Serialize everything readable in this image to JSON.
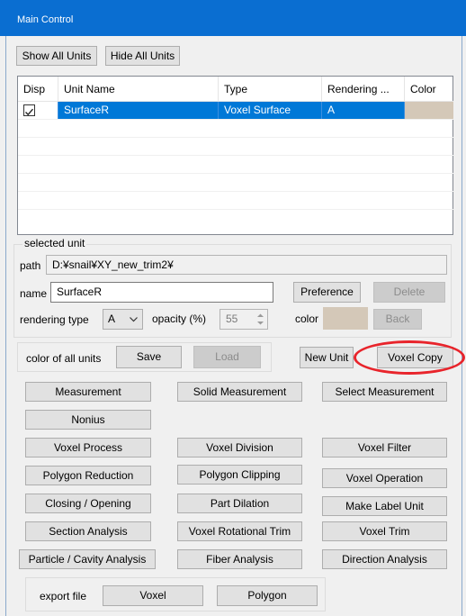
{
  "window": {
    "title": "Main Control"
  },
  "toolbar": {
    "show_all": "Show All Units",
    "hide_all": "Hide All Units"
  },
  "grid": {
    "columns": [
      "Disp",
      "Unit Name",
      "Type",
      "Rendering ...",
      "Color"
    ],
    "rows": [
      {
        "disp_checked": true,
        "name": "SurfaceR",
        "type": "Voxel Surface",
        "rendering": "A",
        "color": "#d4c8b8"
      }
    ]
  },
  "selected": {
    "group_title": "selected unit",
    "path_label": "path",
    "path_value": "D:¥snail¥XY_new_trim2¥",
    "name_label": "name",
    "name_value": "SurfaceR",
    "preference": "Preference",
    "delete": "Delete",
    "rendering_label": "rendering type",
    "rendering_value": "A",
    "opacity_label": "opacity (%)",
    "opacity_value": "55",
    "color_label": "color",
    "color_value": "#d4c8b8",
    "back": "Back"
  },
  "allunits": {
    "label": "color of all units",
    "save": "Save",
    "load": "Load"
  },
  "actions": {
    "new_unit": "New Unit",
    "voxel_copy": "Voxel Copy"
  },
  "tools": {
    "measurement": "Measurement",
    "solid_measurement": "Solid Measurement",
    "select_measurement": "Select Measurement",
    "nonius": "Nonius",
    "voxel_process": "Voxel Process",
    "voxel_division": "Voxel Division",
    "voxel_filter": "Voxel Filter",
    "polygon_reduction": "Polygon Reduction",
    "polygon_clipping": "Polygon Clipping",
    "voxel_operation": "Voxel Operation",
    "closing_opening": "Closing / Opening",
    "part_dilation": "Part Dilation",
    "make_label_unit": "Make Label Unit",
    "section_analysis": "Section Analysis",
    "voxel_rotational_trim": "Voxel Rotational Trim",
    "voxel_trim": "Voxel Trim",
    "particle_cavity": "Particle / Cavity Analysis",
    "fiber_analysis": "Fiber Analysis",
    "direction_analysis": "Direction Analysis"
  },
  "export": {
    "label": "export file",
    "voxel": "Voxel",
    "polygon": "Polygon"
  },
  "colors": {
    "title_bar": "#0a6ed1",
    "selection": "#0078d7",
    "highlight": "#e8242b"
  }
}
